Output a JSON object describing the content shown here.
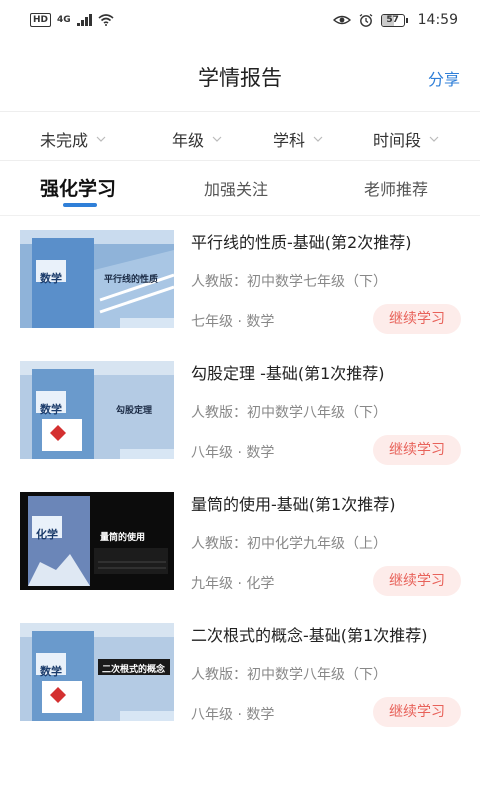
{
  "status_bar": {
    "network_badge": "HD",
    "signal_label": "4G",
    "battery_level": "57",
    "time": "14:59"
  },
  "header": {
    "title": "学情报告",
    "share_label": "分享"
  },
  "filters": [
    {
      "label": "未完成"
    },
    {
      "label": "年级"
    },
    {
      "label": "学科"
    },
    {
      "label": "时间段"
    }
  ],
  "tabs": [
    {
      "label": "强化学习",
      "active": true
    },
    {
      "label": "加强关注",
      "active": false
    },
    {
      "label": "老师推荐",
      "active": false
    }
  ],
  "items": [
    {
      "title": "平行线的性质-基础(第2次推荐)",
      "edition": "人教版：初中数学七年级（下）",
      "meta": "七年级 · 数学",
      "button": "继续学习",
      "cover_subject": "数学",
      "cover_topic": "平行线的性质",
      "cover_theme": "math-blue"
    },
    {
      "title": "勾股定理 -基础(第1次推荐)",
      "edition": "人教版：初中数学八年级（下）",
      "meta": "八年级 · 数学",
      "button": "继续学习",
      "cover_subject": "数学",
      "cover_topic": "勾股定理",
      "cover_theme": "math-blue"
    },
    {
      "title": "量筒的使用-基础(第1次推荐)",
      "edition": "人教版：初中化学九年级（上）",
      "meta": "九年级 · 化学",
      "button": "继续学习",
      "cover_subject": "化学",
      "cover_topic": "量筒的使用",
      "cover_theme": "chem-dark"
    },
    {
      "title": "二次根式的概念-基础(第1次推荐)",
      "edition": "人教版：初中数学八年级（下）",
      "meta": "八年级 · 数学",
      "button": "继续学习",
      "cover_subject": "数学",
      "cover_topic": "二次根式的概念",
      "cover_theme": "math-blue"
    }
  ]
}
